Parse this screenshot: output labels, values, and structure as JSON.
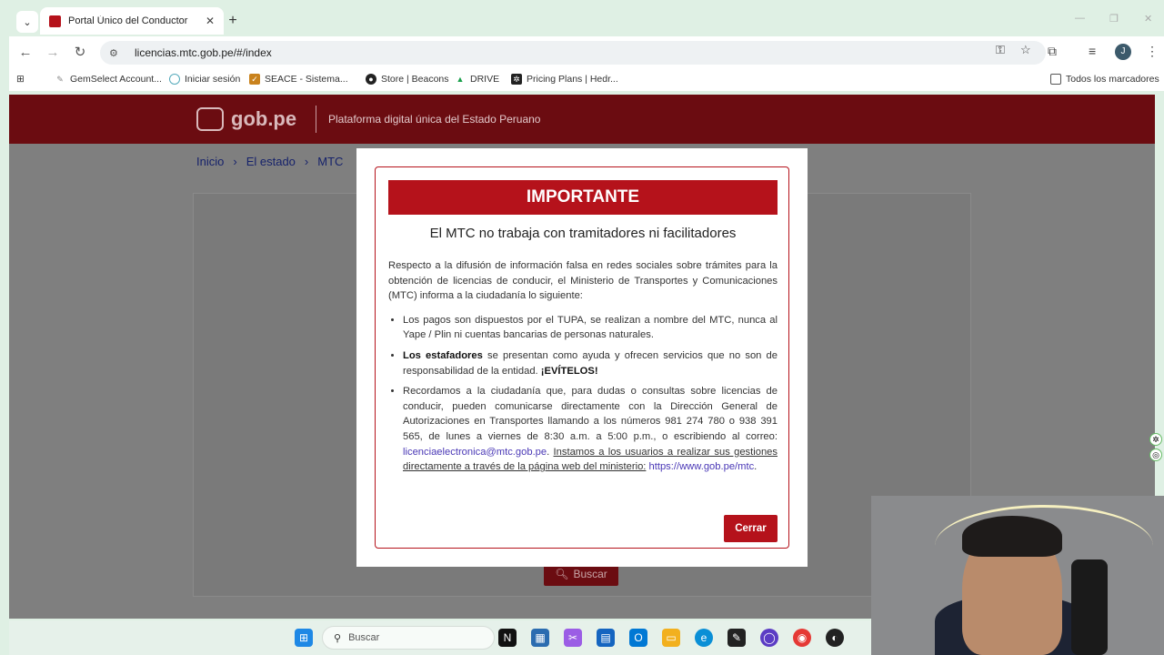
{
  "browser": {
    "tab_title": "Portal Único del Conductor",
    "tab_close": "✕",
    "new_tab": "+",
    "url": "licencias.mtc.gob.pe/#/index",
    "bookmarks": [
      {
        "label": "GemSelect Account..."
      },
      {
        "label": "Iniciar sesión"
      },
      {
        "label": "SEACE - Sistema..."
      },
      {
        "label": "Store | Beacons"
      },
      {
        "label": "DRIVE"
      },
      {
        "label": "Pricing Plans | Hedr..."
      },
      {
        "label": "Todos los marcadores"
      }
    ],
    "avatar_initial": "J"
  },
  "site": {
    "logo_text": "gob.pe",
    "tagline": "Plataforma digital única del Estado Peruano",
    "breadcrumb": [
      "Inicio",
      "El estado",
      "MTC"
    ],
    "search_button": "Buscar"
  },
  "modal": {
    "header": "IMPORTANTE",
    "subtitle": "El MTC no trabaja con tramitadores ni facilitadores",
    "intro": "Respecto a la difusión de información falsa en redes sociales sobre trámites para la obtención de licencias de conducir, el Ministerio de Transportes y Comunicaciones (MTC) informa a la ciudadanía lo siguiente:",
    "bullet1": "Los pagos son dispuestos por el TUPA, se realizan a nombre del MTC, nunca al Yape / Plin ni cuentas bancarias de personas naturales.",
    "bullet2_bold": "Los estafadores",
    "bullet2_text": " se presentan como ayuda y ofrecen servicios que no son de responsabilidad de la entidad. ",
    "bullet2_warn": "¡EVÍTELOS!",
    "bullet3_text": "Recordamos a la ciudadanía que, para dudas o consultas sobre licencias de conducir, pueden comunicarse directamente con la Dirección General de Autorizaciones en Transportes llamando a los números 981 274 780 o 938 391 565, de lunes a viernes de 8:30 a.m. a 5:00 p.m., o escribiendo al correo: ",
    "bullet3_email": "licenciaelectronica@mtc.gob.pe",
    "bullet3_sep": ". ",
    "bullet3_u": "Instamos a los usuarios a realizar sus gestiones directamente a través de la página web del ministerio:",
    "bullet3_url": "https://www.gob.pe/mtc",
    "bullet3_end": ".",
    "close_button": "Cerrar"
  },
  "taskbar": {
    "search_placeholder": "Buscar"
  },
  "colors": {
    "accent_red": "#b5121b",
    "header_dark": "#6b0c11",
    "link": "#4a38b6"
  }
}
